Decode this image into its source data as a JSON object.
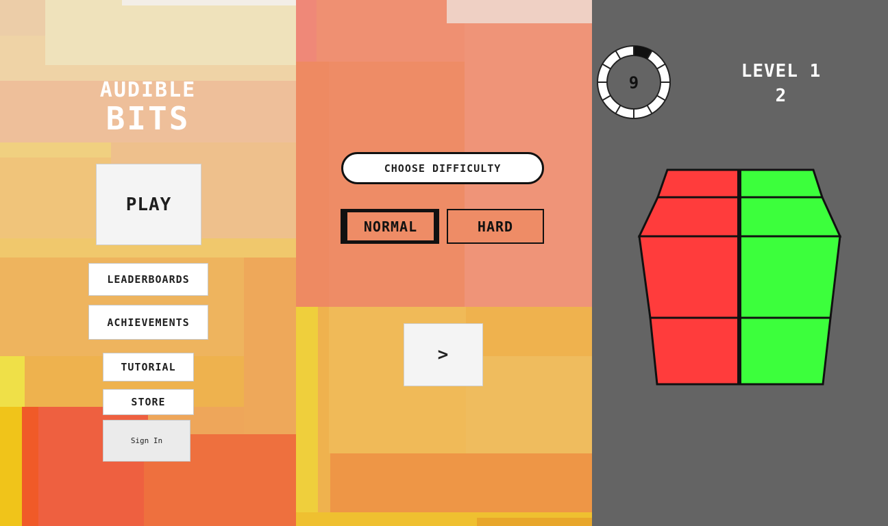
{
  "menu": {
    "title_line1": "AUDIBLE",
    "title_line2": "BITS",
    "play_label": "PLAY",
    "leaderboards_label": "LEADERBOARDS",
    "achievements_label": "ACHIEVEMENTS",
    "tutorial_label": "TUTORIAL",
    "store_label": "STORE",
    "signin_label": "Sign In"
  },
  "difficulty": {
    "heading": "CHOOSE DIFFICULTY",
    "normal_label": "NORMAL",
    "hard_label": "HARD",
    "selected": "NORMAL",
    "next_label": ">"
  },
  "game": {
    "timer_value": "9",
    "timer_segments": 12,
    "timer_filled_segments": 1,
    "level_label": "LEVEL 1",
    "level_sub": "2",
    "tile_colors": [
      "#ff3c3c",
      "#3cff3c"
    ]
  },
  "colors": {
    "menu_bg": "#f0c060",
    "difficulty_bg": "#ee8c66",
    "game_bg": "#646464",
    "red_tile": "#ff3c3c",
    "green_tile": "#3cff3c"
  }
}
